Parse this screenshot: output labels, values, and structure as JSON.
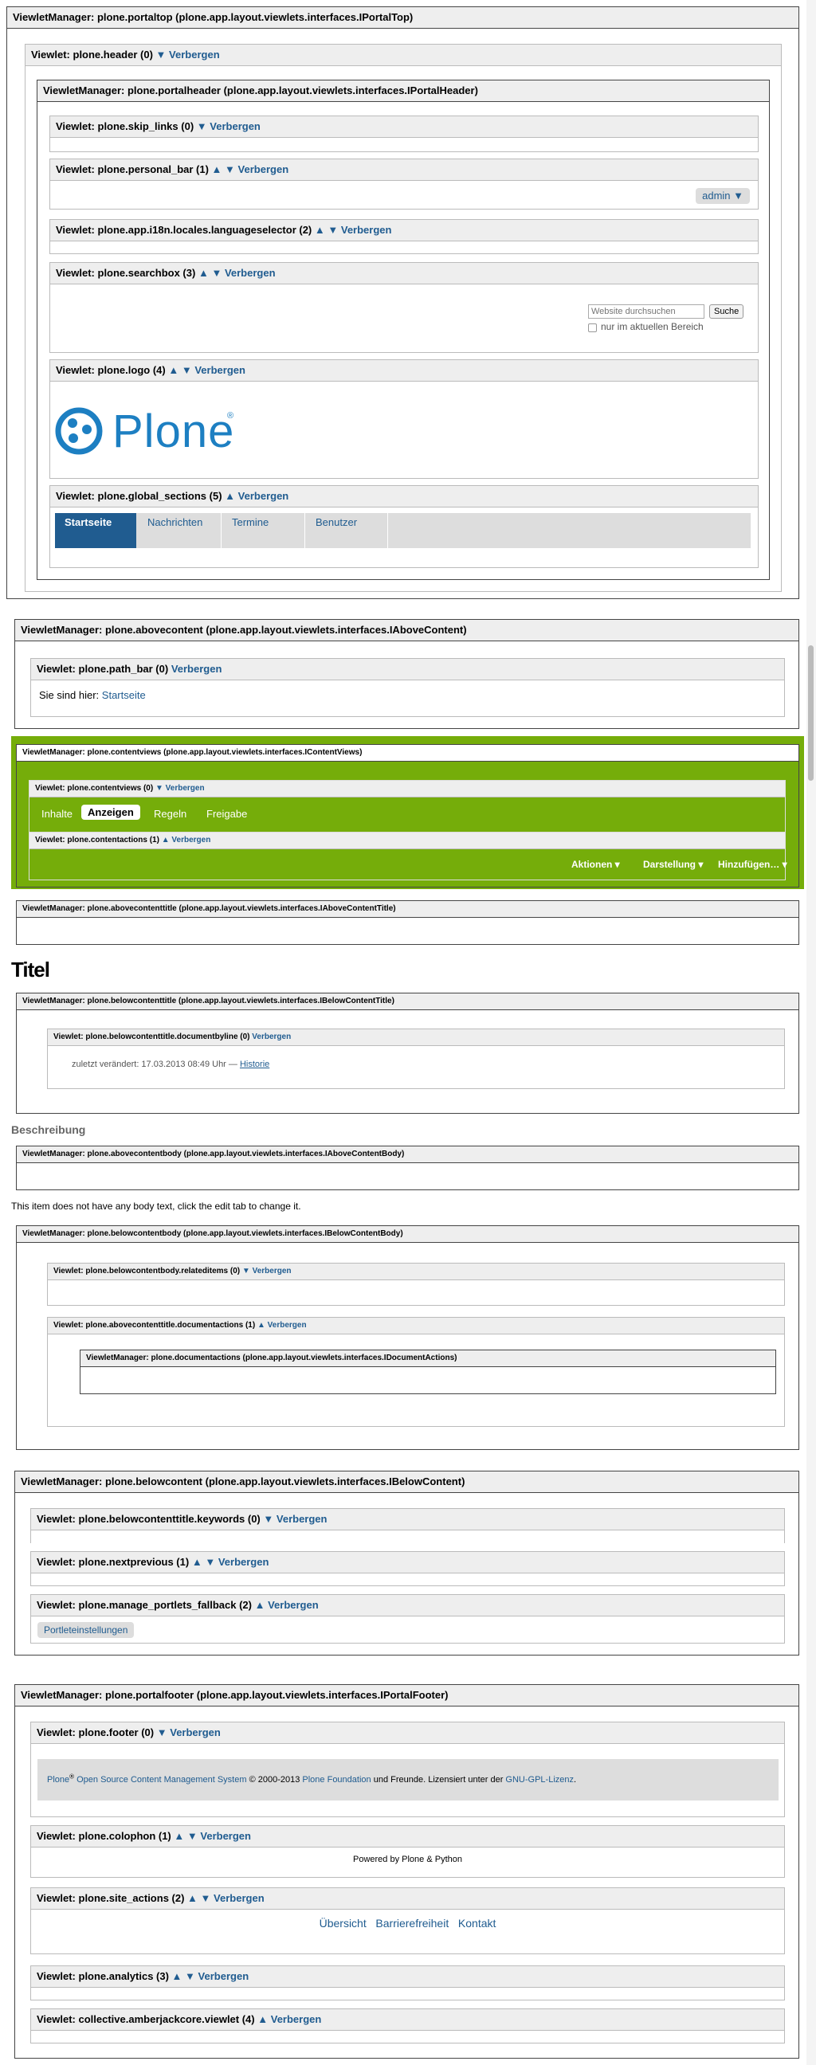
{
  "portaltop": {
    "mgr": "ViewletManager: plone.portaltop (plone.app.layout.viewlets.interfaces.IPortalTop)",
    "header_v": "Viewlet: plone.header (0)",
    "hide": "Verbergen",
    "portalheader_mgr": "ViewletManager: plone.portalheader (plone.app.layout.viewlets.interfaces.IPortalHeader)",
    "skip_v": "Viewlet: plone.skip_links (0)",
    "personal_v": "Viewlet: plone.personal_bar (1)",
    "admin": "admin ▼",
    "lang_v": "Viewlet: plone.app.i18n.locales.languageselector (2)",
    "search_v": "Viewlet: plone.searchbox (3)",
    "search_placeholder": "Website durchsuchen",
    "search_btn": "Suche",
    "search_scope": "nur im aktuellen Bereich",
    "logo_v": "Viewlet: plone.logo (4)",
    "logo_text": "Plone",
    "sections_v": "Viewlet: plone.global_sections (5)",
    "tabs": [
      "Startseite",
      "Nachrichten",
      "Termine",
      "Benutzer"
    ]
  },
  "above": {
    "mgr": "ViewletManager: plone.abovecontent (plone.app.layout.viewlets.interfaces.IAboveContent)",
    "path_v": "Viewlet: plone.path_bar (0)",
    "you_are": "Sie sind hier:",
    "home": "Startseite"
  },
  "cv": {
    "mgr": "ViewletManager: plone.contentviews (plone.app.layout.viewlets.interfaces.IContentViews)",
    "v1": "Viewlet: plone.contentviews (0)",
    "tabs": [
      "Inhalte",
      "Anzeigen",
      "Regeln",
      "Freigabe"
    ],
    "v2": "Viewlet: plone.contentactions (1)",
    "menus": [
      "Aktionen ▾",
      "Darstellung ▾",
      "Hinzufügen… ▾"
    ]
  },
  "act_mgr": "ViewletManager: plone.abovecontenttitle (plone.app.layout.viewlets.interfaces.IAboveContentTitle)",
  "title": "Titel",
  "bct": {
    "mgr": "ViewletManager: plone.belowcontenttitle (plone.app.layout.viewlets.interfaces.IBelowContentTitle)",
    "v": "Viewlet: plone.belowcontenttitle.documentbyline (0)",
    "byline": "zuletzt verändert: 17.03.2013 08:49 Uhr —",
    "history": "Historie"
  },
  "desc": "Beschreibung",
  "acb_mgr": "ViewletManager: plone.abovecontentbody (plone.app.layout.viewlets.interfaces.IAboveContentBody)",
  "body_text": "This item does not have any body text, click the edit tab to change it.",
  "bcb": {
    "mgr": "ViewletManager: plone.belowcontentbody (plone.app.layout.viewlets.interfaces.IBelowContentBody)",
    "v1": "Viewlet: plone.belowcontentbody.relateditems (0)",
    "v2": "Viewlet: plone.abovecontenttitle.documentactions (1)",
    "mgr2": "ViewletManager: plone.documentactions (plone.app.layout.viewlets.interfaces.IDocumentActions)"
  },
  "bc": {
    "mgr": "ViewletManager: plone.belowcontent (plone.app.layout.viewlets.interfaces.IBelowContent)",
    "v1": "Viewlet: plone.belowcontenttitle.keywords (0)",
    "v2": "Viewlet: plone.nextprevious (1)",
    "v3": "Viewlet: plone.manage_portlets_fallback (2)",
    "portlets": "Portleteinstellungen"
  },
  "footer": {
    "mgr": "ViewletManager: plone.portalfooter (plone.app.layout.viewlets.interfaces.IPortalFooter)",
    "v1": "Viewlet: plone.footer (0)",
    "f_plone": "Plone",
    "f_reg": "®",
    "f_oss": "Open Source Content Management System",
    "f_copy": "© 2000-2013",
    "f_found": "Plone Foundation",
    "f_friends": "und Freunde. Lizensiert unter der",
    "f_gpl": "GNU-GPL-Lizenz",
    "f_dot": ".",
    "v2": "Viewlet: plone.colophon (1)",
    "powered": "Powered by Plone & Python",
    "v3": "Viewlet: plone.site_actions (2)",
    "actions": [
      "Übersicht",
      "Barrierefreiheit",
      "Kontakt"
    ],
    "v4": "Viewlet: plone.analytics (3)",
    "v5": "Viewlet: collective.amberjackcore.viewlet (4)"
  },
  "arrows": {
    "up": "▲",
    "down": "▼"
  },
  "colors": {
    "link": "#205c90",
    "tab_active": "#205c90",
    "editbar": "#75ad0a"
  }
}
